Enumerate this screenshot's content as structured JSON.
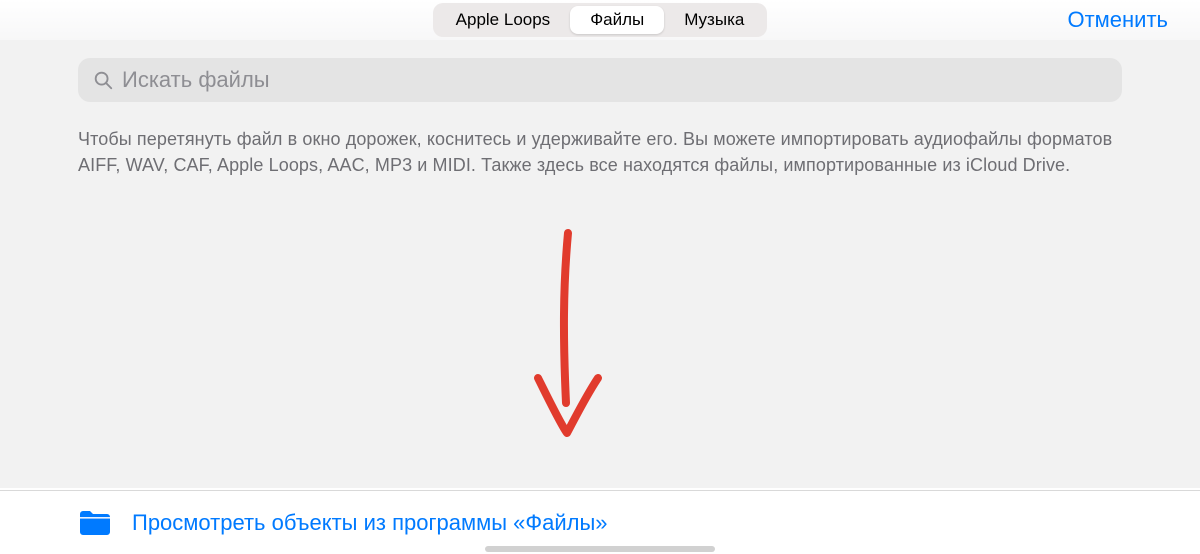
{
  "topbar": {
    "tabs": [
      {
        "label": "Apple Loops",
        "active": false
      },
      {
        "label": "Файлы",
        "active": true
      },
      {
        "label": "Музыка",
        "active": false
      }
    ],
    "cancel_label": "Отменить"
  },
  "search": {
    "placeholder": "Искать файлы",
    "value": ""
  },
  "hint_text": "Чтобы перетянуть файл в окно дорожек, коснитесь и удерживайте его. Вы можете импортировать аудиофайлы форматов AIFF, WAV, CAF, Apple Loops, AAC, MP3 и MIDI. Также здесь все находятся файлы, импортированные из iCloud Drive.",
  "bottom": {
    "browse_label": "Просмотреть объекты из программы «Файлы»"
  },
  "colors": {
    "accent": "#007aff",
    "annotation": "#e13b2d"
  }
}
